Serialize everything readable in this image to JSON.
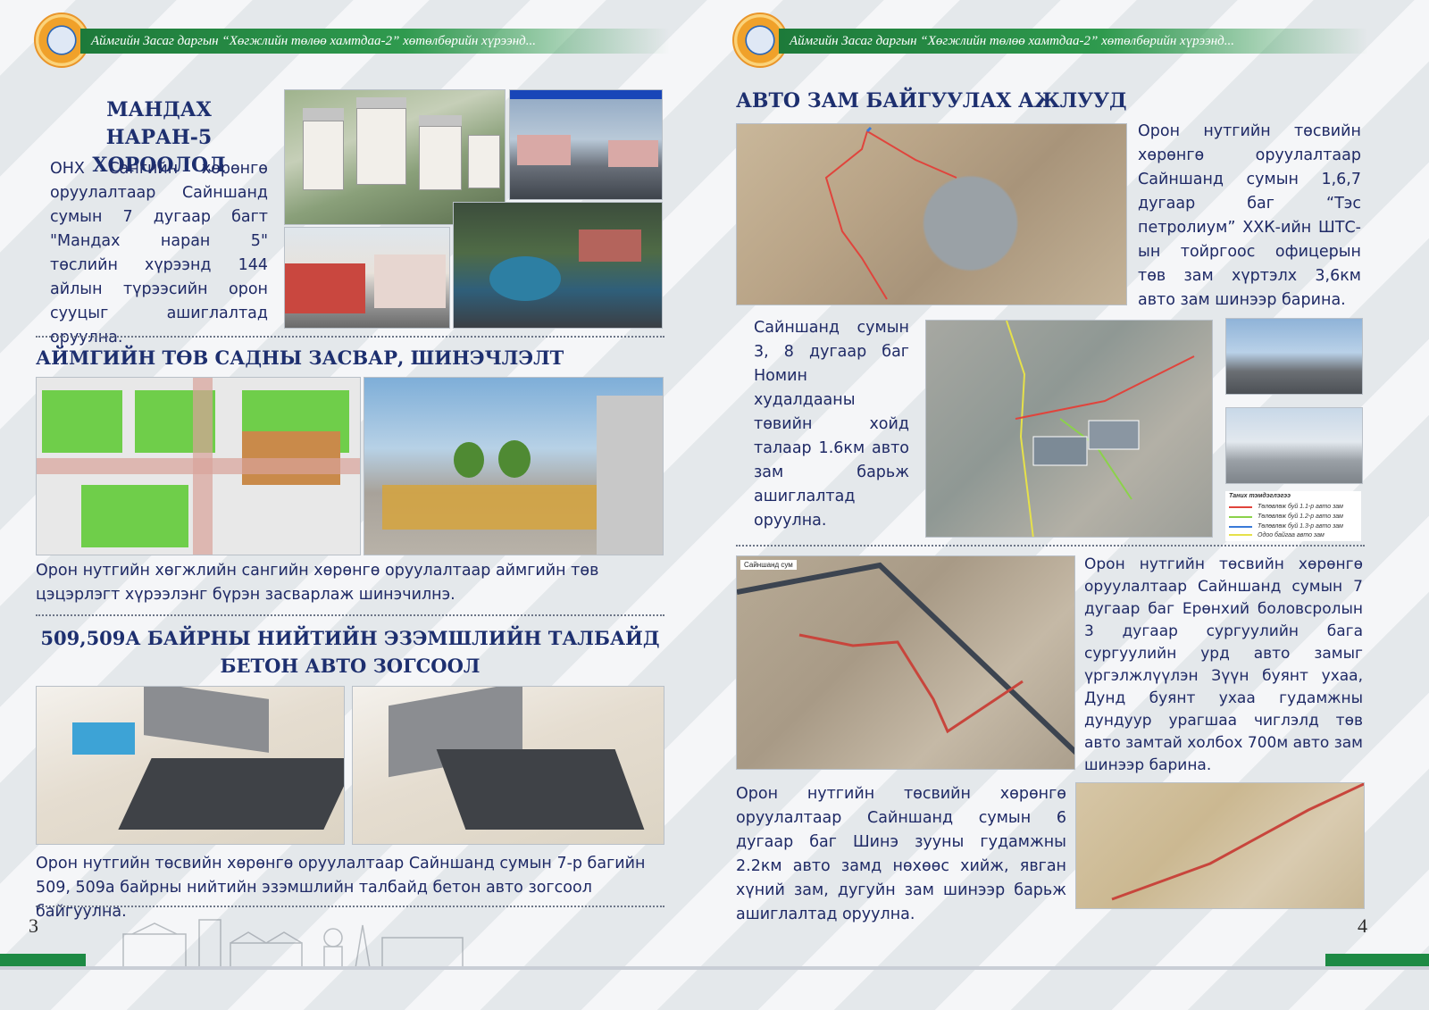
{
  "header": {
    "text": "Аймгийн Засаг даргын “Хөгжлийн төлөө хамтдаа-2” хөтөлбөрийн хүрээнд..."
  },
  "left": {
    "section1": {
      "title": "МАНДАХ НАРАН-5 ХОРООЛОЛ",
      "text": "ОНХ Сангийн хөрөнгө оруулалтаар Сайншанд сумын 7 дугаар багт \"Мандах наран 5\" төслийн хүрээнд 144 айлын түрээсийн орон сууцыг ашиглалтад оруулна."
    },
    "section2": {
      "title": "АЙМГИЙН ТӨВ САДНЫ ЗАСВАР, ШИНЭЧЛЭЛТ",
      "text": "Орон нутгийн хөгжлийн сангийн хөрөнгө оруулалтаар аймгийн төв цэцэрлэгт хүрээлэнг бүрэн засварлаж  шинэчилнэ."
    },
    "section3": {
      "title_line1": "509,509А БАЙРНЫ НИЙТИЙН ЭЗЭМШЛИЙН ТАЛБАЙД",
      "title_line2": "БЕТОН АВТО ЗОГСООЛ",
      "text": "Орон нутгийн төсвийн хөрөнгө оруулалтаар Сайншанд сумын 7-р багийн 509, 509а байрны нийтийн эзэмшлийн талбайд бетон авто зогсоол байгуулна."
    },
    "page_number": "3"
  },
  "right": {
    "title": "АВТО ЗАМ БАЙГУУЛАХ АЖЛУУД",
    "road1": "Орон нутгийн төсвийн хөрөнгө оруулалтаар Сайншанд сумын 1,6,7 дугаар баг “Тэс петролиум” ХХК-ийн ШТС-ын тойргоос офицерын төв зам хүртэлх 3,6км авто зам шинээр барина.",
    "road2": "Сайншанд сумын 3, 8 дугаар баг Номин худалдааны төвийн хойд талаар 1.6км авто зам барьж ашиглалтад оруулна.",
    "road3": "Орон нутгийн төсвийн хөрөнгө оруулалтаар Сайншанд сумын 7 дугаар баг Ерөнхий боловсролын 3 дугаар сургуулийн бага сургуулийн урд авто замыг үргэлжлүүлэн Зүүн буянт ухаа, Дунд буянт ухаа гудамжны дундуур урагшаа чиглэлд төв авто замтай холбох 700м авто зам шинээр барина.",
    "road4": "Орон нутгийн төсвийн хөрөнгө оруулалтаар Сайншанд сумын 6 дугаар баг Шинэ зууны гудамжны 2.2км авто замд нөхөөс хийж, явган хүний зам, дугуйн зам шинээр барьж ашиглалтад оруулна.",
    "map_label": "Сайншанд сум",
    "legend": {
      "title": "Таних тэмдэглэгээ",
      "items": [
        {
          "label": "Төлөвлөж буй 1.1-р авто зам",
          "color": "#e0443c"
        },
        {
          "label": "Төлөвлөж буй 1.2-р авто зам",
          "color": "#8bd24a"
        },
        {
          "label": "Төлөвлөж буй 1.3-р авто зам",
          "color": "#3a7ad8"
        },
        {
          "label": "Одоо байгаа авто зам",
          "color": "#e6e14a"
        }
      ]
    },
    "page_number": "4"
  },
  "colors": {
    "title": "#1d2f6f",
    "header_green": "#1d7a3a",
    "footer_green": "#1d8a44"
  }
}
